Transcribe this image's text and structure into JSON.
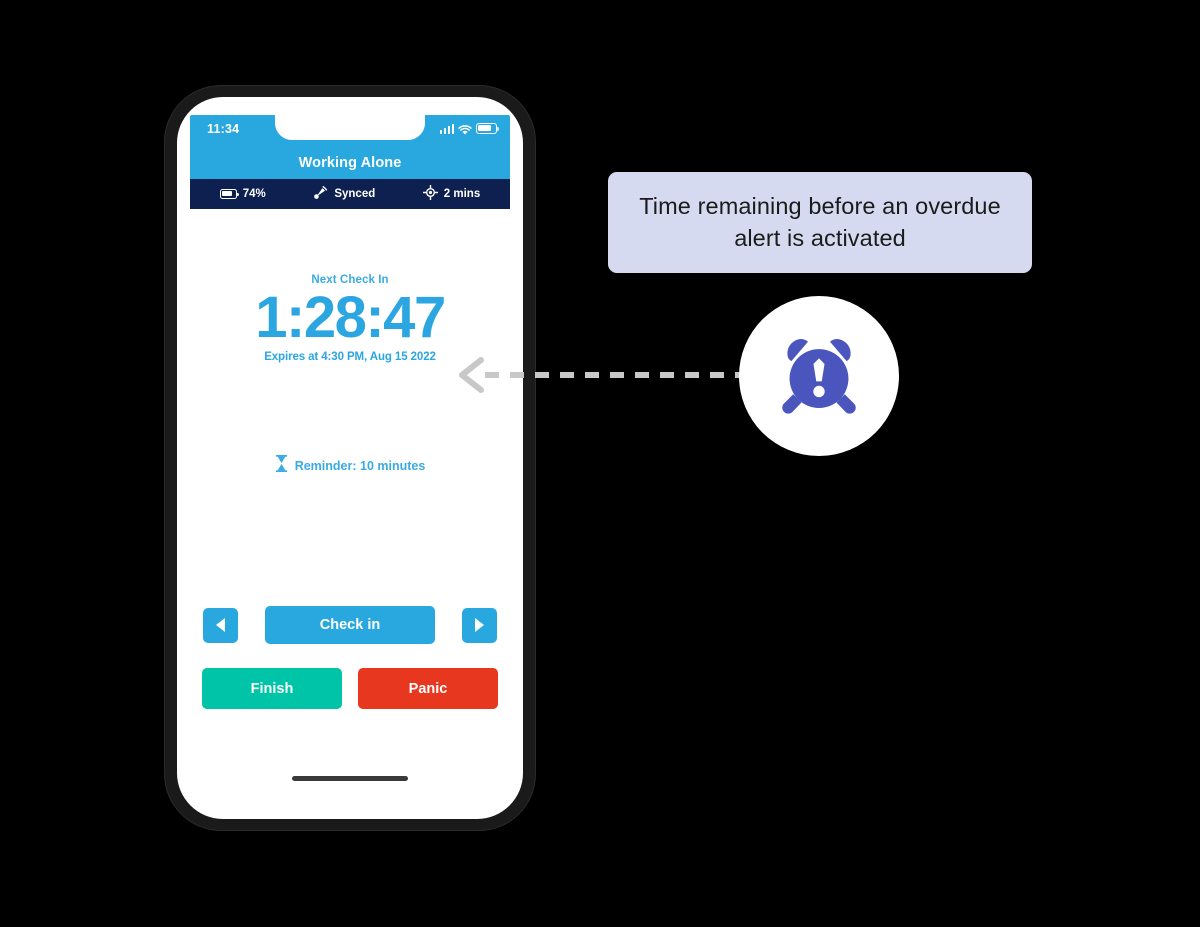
{
  "phone": {
    "status_bar": {
      "time": "11:34",
      "signal_icon": "signal-bars-icon",
      "wifi_icon": "wifi-icon",
      "battery_icon": "battery-icon"
    },
    "header": {
      "title": "Working Alone"
    },
    "info_strip": [
      {
        "icon": "battery-icon",
        "label": "74%"
      },
      {
        "icon": "sync-signal-icon",
        "label": "Synced"
      },
      {
        "icon": "location-target-icon",
        "label": "2 mins"
      }
    ],
    "timer": {
      "next_check_label": "Next Check In",
      "value": "1:28:47",
      "expires_label": "Expires at 4:30 PM, Aug 15 2022"
    },
    "reminder": {
      "icon": "hourglass-icon",
      "label": "Reminder: 10 minutes"
    },
    "actions": {
      "prev_label": "◀",
      "check_in_label": "Check in",
      "next_label": "▶",
      "finish_label": "Finish",
      "panic_label": "Panic"
    }
  },
  "annotation": {
    "callout_text": "Time remaining before an overdue alert is activated",
    "badge_icon": "alarm-clock-alert-icon",
    "arrow_icon": "dashed-left-arrow-icon"
  },
  "colors": {
    "brand_blue": "#29a8df",
    "navy": "#0e2050",
    "timer_blue": "#2ba6e0",
    "finish_green": "#00c4a7",
    "panic_red": "#e8371f",
    "callout_lavender": "#d6daf0",
    "badge_purple": "#4a55bd",
    "arrow_gray": "#c8c8c8",
    "background": "#000000"
  }
}
